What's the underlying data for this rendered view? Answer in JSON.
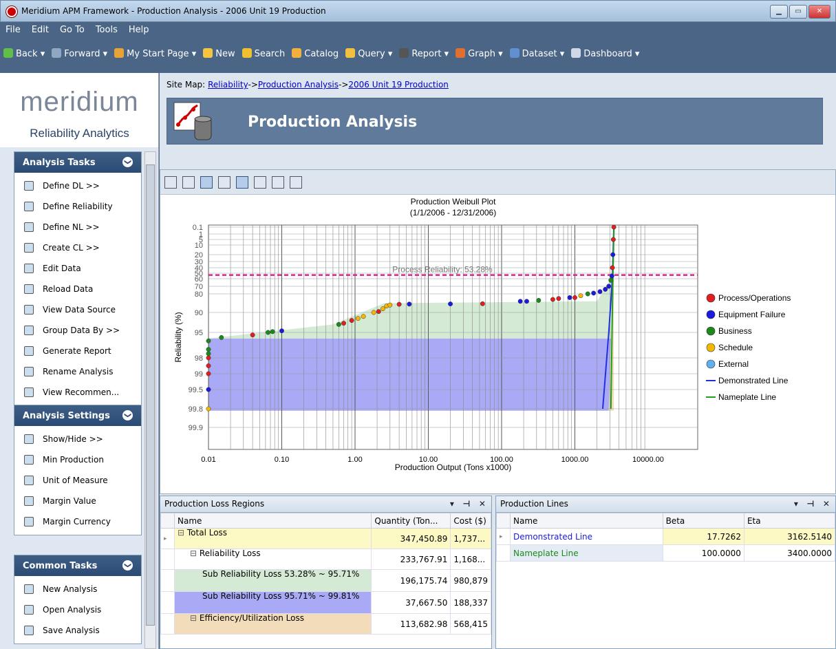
{
  "window": {
    "title": "Meridium APM Framework - Production Analysis - 2006 Unit 19 Production"
  },
  "menu": [
    "File",
    "Edit",
    "Go To",
    "Tools",
    "Help"
  ],
  "toolbar": [
    {
      "label": "Back ▾",
      "color": "#5fbf4a"
    },
    {
      "label": "Forward ▾",
      "color": "#8fa7c0"
    },
    {
      "label": "My Start Page ▾",
      "color": "#e8a338"
    },
    {
      "label": "New",
      "color": "#f5c542"
    },
    {
      "label": "Search",
      "color": "#f0c030"
    },
    {
      "label": "Catalog",
      "color": "#f0b040"
    },
    {
      "label": "Query ▾",
      "color": "#f0c040"
    },
    {
      "label": "Report ▾",
      "color": "#555555"
    },
    {
      "label": "Graph ▾",
      "color": "#e07030"
    },
    {
      "label": "Dataset ▾",
      "color": "#6090d0"
    },
    {
      "label": "Dashboard ▾",
      "color": "#d0d8e8"
    }
  ],
  "brand": {
    "logo": "meridium",
    "sub": "Reliability Analytics"
  },
  "panels": [
    {
      "title": "Analysis Tasks",
      "items": [
        "Define DL >>",
        "Define Reliability",
        "Define NL >>",
        "Create CL >>",
        "Edit Data",
        "Reload Data",
        "View Data Source",
        "Group Data By >>",
        "Generate Report",
        "Rename Analysis",
        "View Recommen..."
      ]
    },
    {
      "title": "Analysis Settings",
      "items": [
        "Show/Hide >>",
        "Min Production",
        "Unit of Measure",
        "Margin Value",
        "Margin Currency"
      ]
    },
    {
      "title": "Common Tasks",
      "items": [
        "New Analysis",
        "Open Analysis",
        "Save Analysis"
      ]
    }
  ],
  "sitemap": {
    "prefix": "Site Map:",
    "links": [
      "Reliability",
      "Production Analysis",
      "2006 Unit 19 Production"
    ],
    "sep": "->"
  },
  "banner": {
    "title": "Production Analysis"
  },
  "chart_data": {
    "type": "scatter",
    "title": "Production Weibull Plot",
    "subtitle": "(1/1/2006 - 12/31/2006)",
    "xlabel": "Production Output (Tons x1000)",
    "ylabel": "Reliability (%)",
    "x_scale": "log",
    "xlim": [
      0.01,
      10000
    ],
    "x_ticks": [
      "0.01",
      "0.10",
      "1.00",
      "10.00",
      "100.00",
      "1000.00",
      "10000.00"
    ],
    "y_ticks": [
      "0.1",
      "1",
      "5",
      "10",
      "20",
      "30",
      "40",
      "50",
      "60",
      "70",
      "80",
      "90",
      "95",
      "98",
      "99",
      "99.5",
      "99.8",
      "99.9"
    ],
    "annotation": "Process Reliability: 53.28%",
    "reliability_line": 53.28,
    "legend": [
      "Process/Operations",
      "Equipment Failure",
      "Business",
      "Schedule",
      "External",
      "Demonstrated Line",
      "Nameplate Line"
    ],
    "colors": {
      "Process/Operations": "#e02020",
      "Equipment Failure": "#1a1ae0",
      "Business": "#1a8a1a",
      "Schedule": "#f5b800",
      "External": "#60b0f0",
      "Demonstrated Line": "#2030e0",
      "Nameplate Line": "#20a020"
    },
    "legend_position": "right",
    "grid": true
  },
  "loss_regions": {
    "title": "Production Loss Regions",
    "columns": [
      "Name",
      "Quantity (Ton...",
      "Cost ($)"
    ],
    "rows": [
      {
        "name": "Total Loss",
        "qty": "347,450.89",
        "cost": "1,737...",
        "level": 0,
        "bg": "#fdf9c4"
      },
      {
        "name": "Reliability Loss",
        "qty": "233,767.91",
        "cost": "1,168...",
        "level": 1,
        "bg": "#ffffff"
      },
      {
        "name": "Sub Reliability Loss 53.28% ~ 95.71%",
        "qty": "196,175.74",
        "cost": "980,879",
        "level": 2,
        "bg": "#d4ead4"
      },
      {
        "name": "Sub Reliability Loss 95.71% ~ 99.81%",
        "qty": "37,667.50",
        "cost": "188,337",
        "level": 2,
        "bg": "#a9a9f5"
      },
      {
        "name": "Efficiency/Utilization Loss",
        "qty": "113,682.98",
        "cost": "568,415",
        "level": 1,
        "bg": "#f3dcb9"
      }
    ]
  },
  "lines": {
    "title": "Production Lines",
    "columns": [
      "Name",
      "Beta",
      "Eta"
    ],
    "rows": [
      {
        "name": "Demonstrated Line",
        "beta": "17.7262",
        "eta": "3162.5140",
        "color": "#1a1ae0",
        "bg": "#fdf9c4"
      },
      {
        "name": "Nameplate Line",
        "beta": "100.0000",
        "eta": "3400.0000",
        "color": "#1a8a1a",
        "bg": "#ffffff"
      }
    ]
  }
}
